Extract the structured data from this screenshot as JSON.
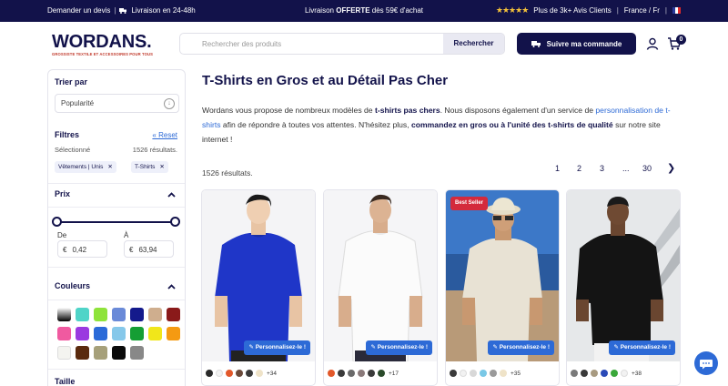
{
  "topbar": {
    "quote": "Demander un devis",
    "delivery": "Livraison en 24-48h",
    "free_prefix": "Livraison ",
    "free_bold": "OFFERTE",
    "free_suffix": " dès 59€ d'achat",
    "rating_stars": "★★★★★",
    "reviews": "Plus de 3k+ Avis Clients",
    "locale": "France / Fr"
  },
  "header": {
    "logo": "WORDANS.",
    "logo_tagline": "GROSSISTE TEXTILE ET ACCESSOIRES POUR TOUS",
    "search_placeholder": "Rechercher des produits",
    "search_button": "Rechercher",
    "follow_order": "Suivre ma commande",
    "cart_count": "0"
  },
  "sidebar": {
    "sort_title": "Trier par",
    "sort_value": "Popularité",
    "filters_title": "Filtres",
    "reset": "« Reset",
    "selected_label": "Sélectionné",
    "selected_count": "1526 résultats.",
    "chips": [
      "Vêtements | Unis",
      "T-Shirts"
    ],
    "price_title": "Prix",
    "price_min_label": "De",
    "price_max_label": "À",
    "currency": "€",
    "price_min": "0,42",
    "price_max": "63,94",
    "colors_title": "Couleurs",
    "size_title": "Taille"
  },
  "colors": {
    "swatches": [
      "gradient-black",
      "#4fd4c8",
      "#8ee33a",
      "#6a8ad8",
      "#141a8c",
      "#cfae8e",
      "#8a1a1a",
      "#e5202a",
      "#f05aa0",
      "#9a3ae0",
      "#2b6ad8",
      "#86c8ea",
      "#159e34",
      "#f1e61a",
      "#f59a12",
      "#f4f4f0",
      "#5a2a0e",
      "#a6a07a",
      "#0a0a0a",
      "#888888"
    ]
  },
  "main": {
    "title": "T-Shirts en Gros et au Détail Pas Cher",
    "intro_1": "Wordans vous propose de nombreux modèles de ",
    "intro_b1": "t-shirts pas chers",
    "intro_2": ". Nous disposons également d'un service de ",
    "intro_link": "personnalisation de t-shirts",
    "intro_3": " afin de répondre à toutes vos attentes. N'hésitez plus, ",
    "intro_b2": "commandez en gros ou à l'unité des t-shirts de qualité",
    "intro_4": " sur notre site internet !",
    "results": "1526 résultats.",
    "pages": [
      "1",
      "2",
      "3",
      "...",
      "30"
    ],
    "next": "❯"
  },
  "products": [
    {
      "personalize": "Personnalisez-le !",
      "badge": "",
      "more": "+34",
      "colors": [
        "#2a2a2a",
        "#f2f2f2",
        "#e2582a",
        "#6a4a3a",
        "#3a3a3a",
        "#efe3c8"
      ]
    },
    {
      "personalize": "Personnalisez-le !",
      "badge": "",
      "more": "+17",
      "colors": [
        "#e2582a",
        "#3a3a3a",
        "#6a6a6a",
        "#8a7a7a",
        "#3a3a3a",
        "#2a4a2a"
      ]
    },
    {
      "personalize": "Personnalisez-le !",
      "badge": "Best Seller",
      "more": "+35",
      "colors": [
        "#3a3a3a",
        "#f2f2f2",
        "#d8d8d8",
        "#7ac8e6",
        "#9a9a9a",
        "#efe3c8"
      ]
    },
    {
      "personalize": "Personnalisez-le !",
      "badge": "",
      "more": "+38",
      "colors": [
        "#7a7a7a",
        "#3a3a3a",
        "#a89a80",
        "#2a4ab8",
        "#3aa83a",
        "#f2f2f2"
      ]
    }
  ]
}
